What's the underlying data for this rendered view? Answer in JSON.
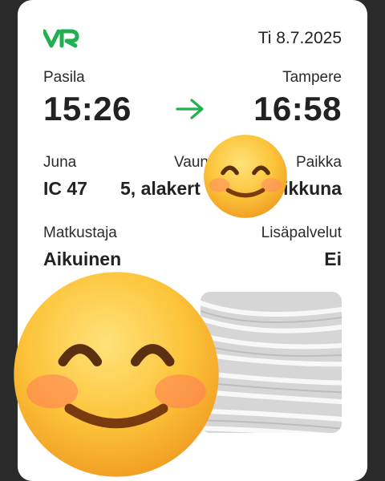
{
  "header": {
    "date": "Ti 8.7.2025"
  },
  "route": {
    "from_station": "Pasila",
    "to_station": "Tampere",
    "departure_time": "15:26",
    "arrival_time": "16:58"
  },
  "details": {
    "train_label": "Juna",
    "train_value": "IC 47",
    "car_label": "Vaun",
    "car_value": "5, alakert",
    "seat_label": "Paikka",
    "seat_value": "ikkuna"
  },
  "passenger": {
    "label": "Matkustaja",
    "value": "Aikuinen",
    "extras_label": "Lisäpalvelut",
    "extras_value": "Ei"
  },
  "colors": {
    "brand_green": "#20b050",
    "card_bg": "#ffffff",
    "app_bg": "#2b2b2b"
  },
  "icons": [
    "vr-logo",
    "arrow-right-icon",
    "smiling-face-emoji",
    "ticket-code"
  ]
}
